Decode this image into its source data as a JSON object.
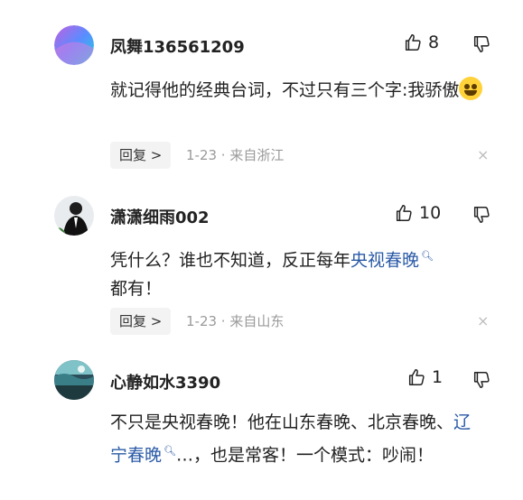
{
  "comments": [
    {
      "username": "凤舞136561209",
      "likes": "8",
      "text": "就记得他的经典台词，不过只有三个字:我骄傲",
      "reply_label": "回复 >",
      "meta": "1-23 · 来自浙江",
      "close": "×",
      "emoji_icon": "laugh-tears-emoji-icon"
    },
    {
      "username": "潇潇细雨002",
      "likes": "10",
      "text_before": "凭什么？谁也不知道，反正每年",
      "link": "央视春晚",
      "text_after": "都有！",
      "reply_label": "回复 >",
      "meta": "1-23 · 来自山东",
      "close": "×"
    },
    {
      "username": "心静如水3390",
      "likes": "1",
      "text_before": "不只是央视春晚！他在山东春晚、北京春晚、",
      "link": "辽宁春晚",
      "text_after": "…，也是常客！一个模式：吵闹！"
    }
  ],
  "colors": {
    "link": "#2a5aa6",
    "meta": "#9a9a9a",
    "reply_bg": "#f3f3f3"
  }
}
